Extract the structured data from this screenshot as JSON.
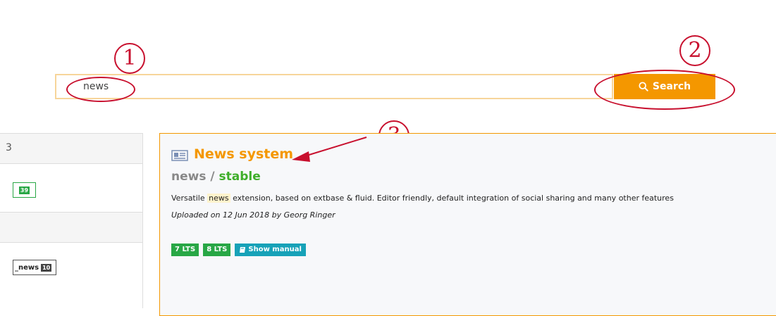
{
  "search": {
    "value": "news",
    "button_label": "Search"
  },
  "annotations": [
    "1",
    "2",
    "3"
  ],
  "sidebar": {
    "section1_label": "3",
    "section1_badge": "39",
    "facet_tag": "_news",
    "facet_count": "10"
  },
  "result": {
    "title": "News system",
    "ext_key": "news",
    "separator": " / ",
    "state": "stable",
    "description_before": "Versatile ",
    "description_highlight": "news",
    "description_after": " extension, based on extbase & fluid. Editor friendly, default integration of social sharing and many other features",
    "uploaded": "Uploaded on 12 Jun 2018 by Georg Ringer",
    "badges": [
      "7 LTS",
      "8 LTS"
    ],
    "manual_label": "Show manual"
  },
  "colors": {
    "accent": "#f49700",
    "annotation": "#c8102e",
    "state_green": "#3fae2a",
    "badge_green": "#28a745",
    "manual_teal": "#17a2b8"
  }
}
